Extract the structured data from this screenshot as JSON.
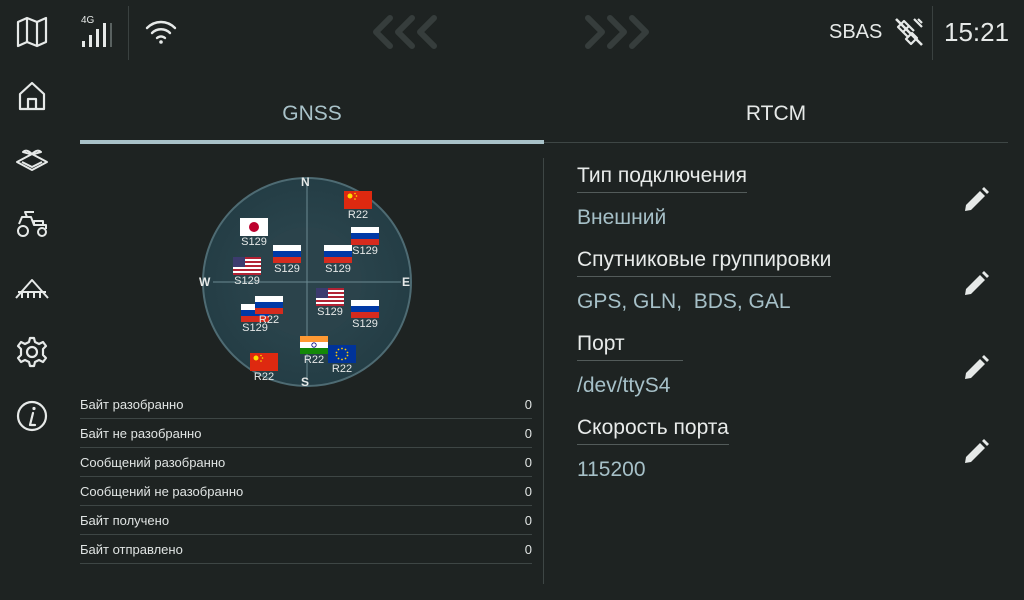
{
  "topbar": {
    "network_type": "4G",
    "sbas_label": "SBAS",
    "clock": "15:21",
    "left_arrows": "‹‹‹",
    "right_arrows": "›››"
  },
  "sidebar": {
    "items": [
      {
        "icon": "map-icon"
      },
      {
        "icon": "home-icon"
      },
      {
        "icon": "field-icon"
      },
      {
        "icon": "tractor-icon"
      },
      {
        "icon": "implement-icon"
      },
      {
        "icon": "gear-icon"
      },
      {
        "icon": "info-icon"
      }
    ]
  },
  "tabs": [
    {
      "label": "GNSS",
      "active": true
    },
    {
      "label": "RTCM",
      "active": false
    }
  ],
  "skyplot": {
    "north": "N",
    "south": "S",
    "east": "E",
    "west": "W",
    "satellites": [
      {
        "flag": "china",
        "label": "R22"
      },
      {
        "flag": "japan",
        "label": "S129"
      },
      {
        "flag": "russia",
        "label": "S129"
      },
      {
        "flag": "russia",
        "label": "S129"
      },
      {
        "flag": "russia",
        "label": "S129"
      },
      {
        "flag": "usa",
        "label": "S129"
      },
      {
        "flag": "usa",
        "label": "S129"
      },
      {
        "flag": "russia",
        "label": "S129"
      },
      {
        "flag": "russia",
        "label": "S129"
      },
      {
        "flag": "russia",
        "label": "R22"
      },
      {
        "flag": "china",
        "label": "R22"
      },
      {
        "flag": "india",
        "label": "R22"
      },
      {
        "flag": "eu",
        "label": "R22"
      }
    ]
  },
  "stats": [
    {
      "label": "Байт разобранно",
      "value": "0"
    },
    {
      "label": "Байт не разобранно",
      "value": "0"
    },
    {
      "label": "Сообщений разобранно",
      "value": "0"
    },
    {
      "label": "Сообщений не разобранно",
      "value": "0"
    },
    {
      "label": "Байт получено",
      "value": "0"
    },
    {
      "label": "Байт отправлено",
      "value": "0"
    }
  ],
  "settings": [
    {
      "label": "Тип подключения",
      "value": "Внешний"
    },
    {
      "label": "Спутниковые группировки",
      "value": "GPS, GLN,  BDS, GAL"
    },
    {
      "label": "Порт",
      "value": "/dev/ttyS4"
    },
    {
      "label": "Скорость порта",
      "value": "115200"
    }
  ],
  "colors": {
    "background": "#1e2322",
    "accent": "#a9c2c9",
    "value_text": "#a6c0c8"
  }
}
